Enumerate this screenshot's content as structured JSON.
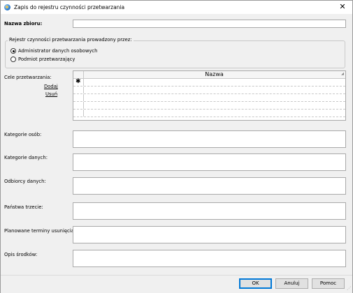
{
  "window": {
    "title": "Zapis do rejestru czynności przetwarzania",
    "close_glyph": "✕"
  },
  "form": {
    "nazwa_label": "Nazwa zbioru:",
    "group_legend": "Rejestr czynności przetwarzania prowadzony przez:",
    "radio_admin": "Administrator danych osobowych",
    "radio_processor": "Podmiot przetwarzający",
    "cele_label": "Cele przetwarzania:",
    "add_link": "Dodaj",
    "remove_link": "Usuń",
    "grid_header": "Nazwa",
    "new_row_marker": "✱",
    "kategorie_osob_label": "Kategorie osób:",
    "kategorie_danych_label": "Kategorie danych:",
    "odbiorcy_label": "Odbiorcy danych:",
    "panstwa_label": "Państwa trzecie:",
    "terminy_label": "Planowane terminy usunięcia:",
    "opis_label": "Opis środków:"
  },
  "buttons": {
    "ok": "OK",
    "cancel": "Anuluj",
    "help": "Pomoc"
  },
  "colors": {
    "accent": "#0078d7",
    "background": "#f0f0f0"
  }
}
